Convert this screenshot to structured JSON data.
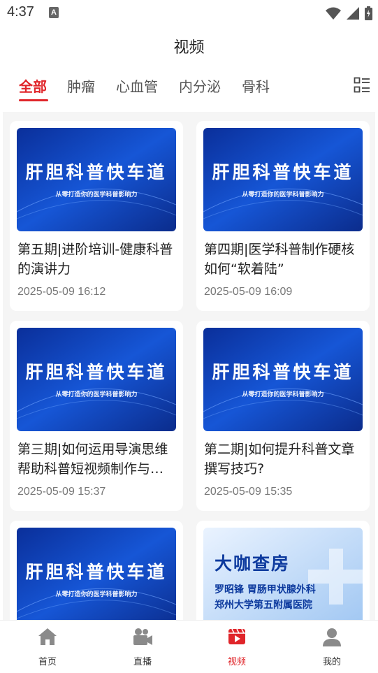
{
  "status": {
    "time": "4:37",
    "a_badge": "A"
  },
  "page_title": "视频",
  "tabs": [
    {
      "label": "全部",
      "active": true
    },
    {
      "label": "肿瘤",
      "active": false
    },
    {
      "label": "心血管",
      "active": false
    },
    {
      "label": "内分泌",
      "active": false
    },
    {
      "label": "骨科",
      "active": false
    }
  ],
  "videos": [
    {
      "thumb_title": "肝胆科普快车道",
      "thumb_subtitle": "从零打造你的医学科普影响力",
      "title": "第五期|进阶培训-健康科普的演讲力",
      "date": "2025-05-09 16:12"
    },
    {
      "thumb_title": "肝胆科普快车道",
      "thumb_subtitle": "从零打造你的医学科普影响力",
      "title": "第四期|医学科普制作硬核如何“软着陆”",
      "date": "2025-05-09 16:09"
    },
    {
      "thumb_title": "肝胆科普快车道",
      "thumb_subtitle": "从零打造你的医学科普影响力",
      "title": "第三期|如何运用导演思维帮助科普短视频制作与…",
      "date": "2025-05-09 15:37"
    },
    {
      "thumb_title": "肝胆科普快车道",
      "thumb_subtitle": "从零打造你的医学科普影响力",
      "title": "第二期|如何提升科普文章撰写技巧?",
      "date": "2025-05-09 15:35"
    },
    {
      "thumb_title": "肝胆科普快车道",
      "thumb_subtitle": "从零打造你的医学科普影响力"
    },
    {
      "thumb_title": "大咖查房",
      "thumb_line1": "罗昭锋 胃肠甲状腺外科",
      "thumb_line2": "郑州大学第五附属医院"
    }
  ],
  "bottom_nav": [
    {
      "label": "首页",
      "icon": "home-icon",
      "active": false
    },
    {
      "label": "直播",
      "icon": "live-camera-icon",
      "active": false
    },
    {
      "label": "视频",
      "icon": "video-icon",
      "active": true
    },
    {
      "label": "我的",
      "icon": "profile-icon",
      "active": false
    }
  ],
  "colors": {
    "accent": "#e0252a",
    "thumb_blue": "#1447c4",
    "background": "#f5f5f5"
  }
}
